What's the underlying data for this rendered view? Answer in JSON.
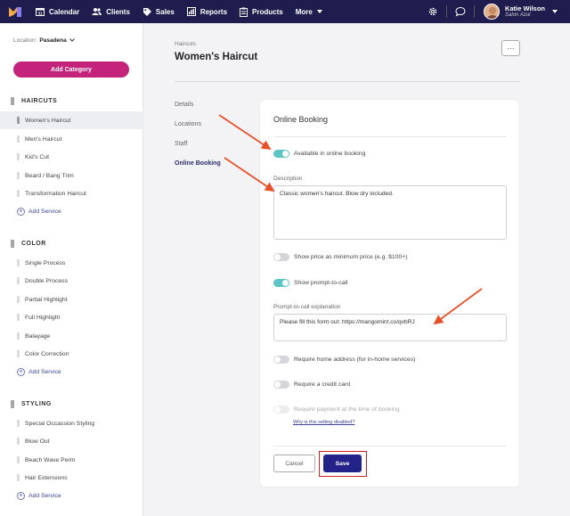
{
  "topbar": {
    "nav": [
      {
        "label": "Calendar",
        "icon": "calendar-icon"
      },
      {
        "label": "Clients",
        "icon": "users-icon"
      },
      {
        "label": "Sales",
        "icon": "tag-icon"
      },
      {
        "label": "Reports",
        "icon": "chart-icon"
      },
      {
        "label": "Products",
        "icon": "clipboard-icon"
      },
      {
        "label": "More",
        "icon": "caret-down-icon"
      }
    ],
    "calendar_day": "31",
    "user": {
      "name": "Katie Wilson",
      "org": "Salon Azul"
    }
  },
  "sidebar": {
    "location_label": "Location:",
    "location_value": "Pasadena",
    "add_category_label": "Add Category",
    "add_service_label": "Add Service",
    "categories": [
      {
        "name": "HAIRCUTS",
        "services": [
          "Women's Haircut",
          "Men's Haircut",
          "Kid's Cut",
          "Beard / Bang Trim",
          "Transformation Haircut"
        ]
      },
      {
        "name": "COLOR",
        "services": [
          "Single Process",
          "Double Process",
          "Partial Highlight",
          "Full Highlight",
          "Balayage",
          "Color Correction"
        ]
      },
      {
        "name": "STYLING",
        "services": [
          "Special Occassion Styling",
          "Blow Out",
          "Beach Wave Perm",
          "Hair Extensions"
        ]
      }
    ]
  },
  "main": {
    "breadcrumb": "Haircuts",
    "title": "Women's Haircut",
    "more_label": "···",
    "tabs": [
      "Details",
      "Locations",
      "Staff",
      "Online Booking"
    ],
    "active_tab": "Online Booking"
  },
  "card": {
    "title": "Online Booking",
    "available_label": "Available in online booking",
    "description_label": "Description",
    "description_value": "Classic women's haircut. Blow dry included.",
    "show_price_label": "Show price as minimum price (e.g. $100+)",
    "show_prompt_label": "Show prompt-to-call",
    "prompt_label": "Prompt-to-call explanation",
    "prompt_value": "Please fill this form out: https://mangomint.co/qvbRJ",
    "require_address_label": "Require home address (for in-home services)",
    "require_card_label": "Require a credit card",
    "require_payment_label": "Require payment at the time of booking",
    "disabled_help_link": "Why is this setting disabled?",
    "cancel_label": "Cancel",
    "save_label": "Save",
    "toggles": {
      "available": true,
      "show_price": false,
      "show_prompt": true,
      "require_address": false,
      "require_card": false,
      "require_payment": false
    }
  },
  "colors": {
    "topbar": "#1f1d4d",
    "accent": "#c4237b",
    "primary": "#23238a",
    "toggle_on": "#5dc5c4",
    "annotation": "#e8502a"
  }
}
